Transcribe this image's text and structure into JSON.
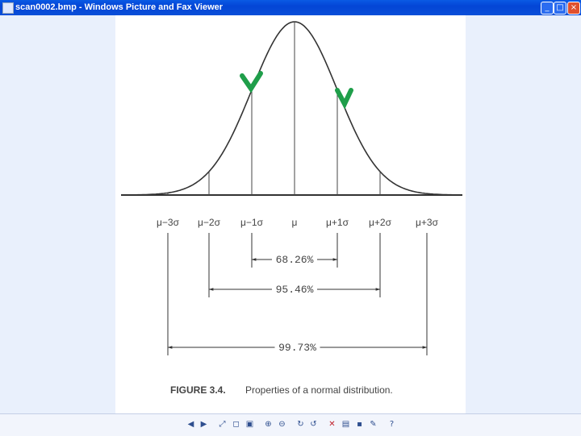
{
  "window": {
    "title": "scan0002.bmp - Windows Picture and Fax Viewer"
  },
  "controls": {
    "minimize": "_",
    "maximize": "□",
    "close": "×"
  },
  "figure": {
    "tick_labels": [
      "μ−3σ",
      "μ−2σ",
      "μ−1σ",
      "μ",
      "μ+1σ",
      "μ+2σ",
      "μ+3σ"
    ],
    "intervals": [
      "68.26%",
      "95.46%",
      "99.73%"
    ],
    "caption_label": "FIGURE 3.4.",
    "caption_text": "Properties of a normal distribution."
  },
  "toolbar": {
    "icons": [
      "previous-image-icon",
      "next-image-icon",
      "best-fit-icon",
      "actual-size-icon",
      "slideshow-icon",
      "zoom-in-icon",
      "zoom-out-icon",
      "rotate-clockwise-icon",
      "rotate-counterclockwise-icon",
      "delete-icon",
      "print-icon",
      "save-icon",
      "edit-icon",
      "help-icon"
    ]
  },
  "colors": {
    "title_bar": "#0a52dc",
    "annotation_marks": "#1f9e4a",
    "curve": "#333333"
  }
}
